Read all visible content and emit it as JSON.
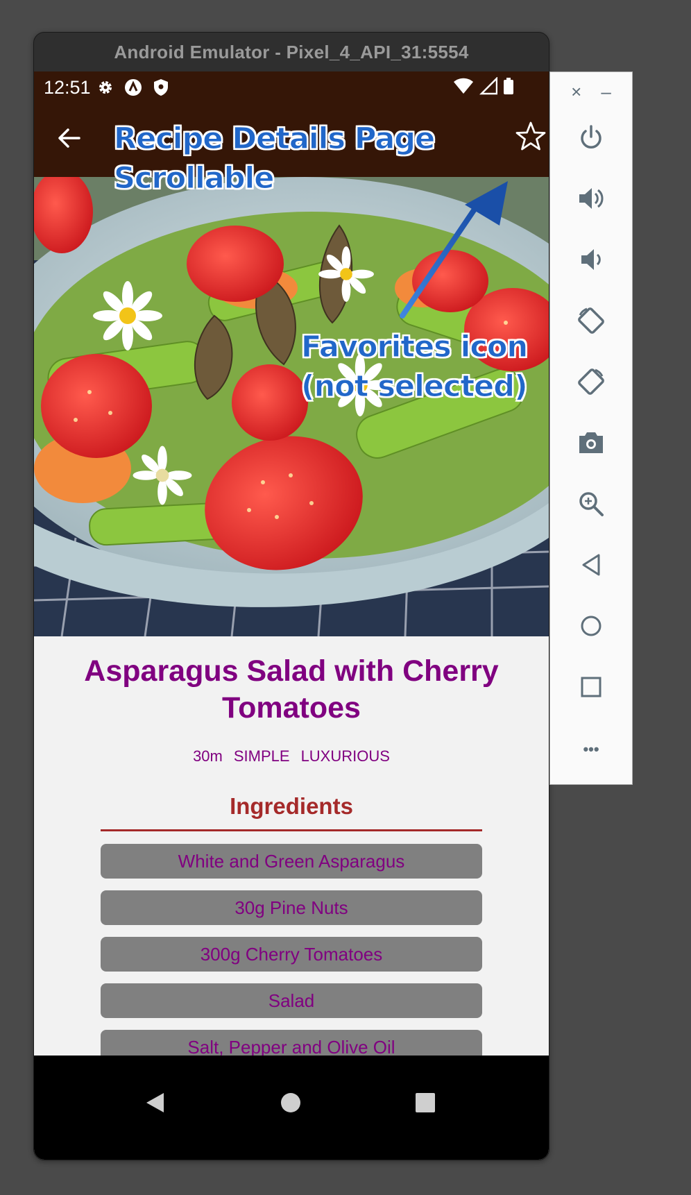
{
  "emulator": {
    "window_title": "Android Emulator - Pixel_4_API_31:5554"
  },
  "status_bar": {
    "time": "12:51",
    "icons": [
      "gear-icon",
      "a-icon",
      "shield-icon",
      "wifi-icon",
      "signal-icon",
      "battery-icon"
    ]
  },
  "app_bar": {
    "back_icon": "arrow-left-icon",
    "favorite_icon": "star-outline-icon",
    "background_color": "#351607"
  },
  "recipe": {
    "title": "Asparagus Salad with Cherry Tomatoes",
    "duration": "30m",
    "complexity": "SIMPLE",
    "affordability": "LUXURIOUS",
    "ingredients_header": "Ingredients",
    "ingredients": [
      "White and Green Asparagus",
      "30g Pine Nuts",
      "300g Cherry Tomatoes",
      "Salad",
      "Salt, Pepper and Olive Oil"
    ],
    "title_color": "#800080",
    "header_color": "#a52a2a"
  },
  "annotations": {
    "page_label_line1": "Recipe Details Page",
    "page_label_line2": "Scrollable",
    "favorites_label_line1": "Favorites icon",
    "favorites_label_line2": "(not selected)",
    "color": "#2167c9"
  },
  "side_toolbar": {
    "close_label": "×",
    "minimize_label": "–",
    "buttons": [
      "power-icon",
      "volume-up-icon",
      "volume-down-icon",
      "rotate-left-icon",
      "rotate-right-icon",
      "camera-icon",
      "zoom-icon",
      "back-icon",
      "home-icon",
      "overview-icon",
      "more-icon"
    ],
    "more_label": "•••"
  },
  "nav_bar": {
    "buttons": [
      "nav-back-icon",
      "nav-home-icon",
      "nav-recents-icon"
    ]
  }
}
